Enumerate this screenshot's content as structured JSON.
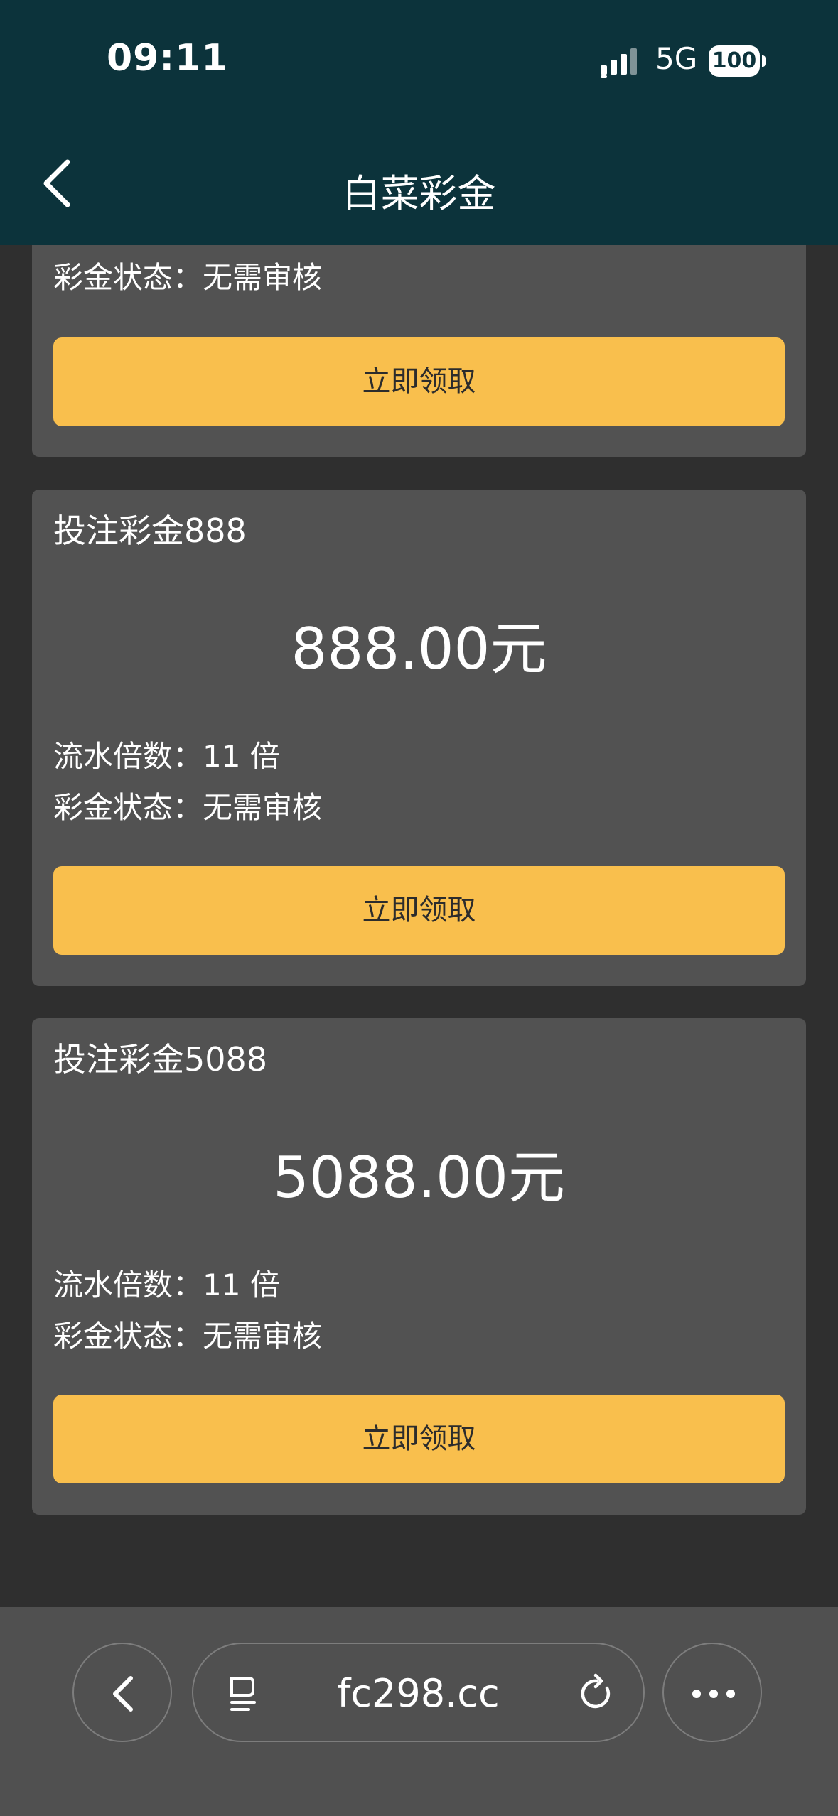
{
  "status_bar": {
    "time": "09:11",
    "network": "5G",
    "battery": "100"
  },
  "header": {
    "title": "白菜彩金"
  },
  "cards": [
    {
      "status": "彩金状态：无需审核",
      "button": "立即领取"
    },
    {
      "title": "投注彩金888",
      "amount": "888.00元",
      "multiplier": "流水倍数：11 倍",
      "status": "彩金状态：无需审核",
      "button": "立即领取"
    },
    {
      "title": "投注彩金5088",
      "amount": "5088.00元",
      "multiplier": "流水倍数：11 倍",
      "status": "彩金状态：无需审核",
      "button": "立即领取"
    }
  ],
  "browser": {
    "url": "fc298.cc"
  },
  "icons": {
    "back": "chevron-left-icon",
    "signal": "signal-icon",
    "battery": "battery-icon",
    "reader": "reader-mode-icon",
    "reload": "reload-icon",
    "more": "more-icon"
  },
  "colors": {
    "header_bg": "#0c333b",
    "page_bg": "#2f2f2f",
    "card_bg": "#525252",
    "button_bg": "#f9bf4d",
    "toolbar_bg": "#505050"
  }
}
